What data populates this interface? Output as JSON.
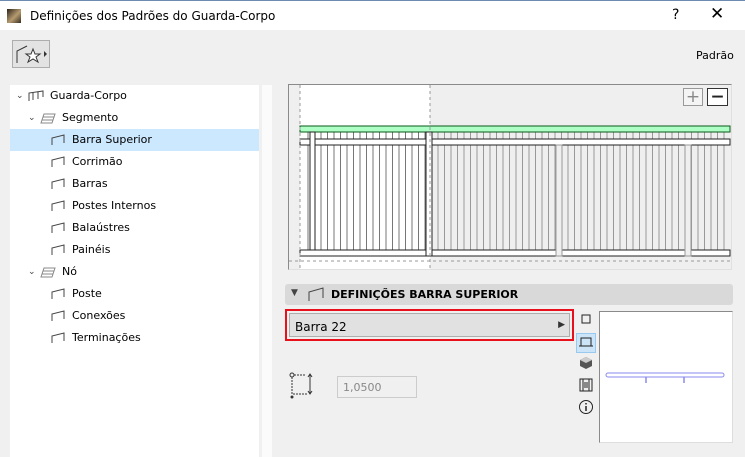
{
  "window": {
    "title": "Definições dos Padrões do Guarda-Corpo",
    "help": "?",
    "close": "✕"
  },
  "toolbar": {
    "favorites_icon": "railing-star-icon",
    "mode_label": "Padrão"
  },
  "tree": [
    {
      "label": "Guarda-Corpo",
      "level": 0,
      "expanded": true
    },
    {
      "label": "Segmento",
      "level": 1,
      "expanded": true
    },
    {
      "label": "Barra Superior",
      "level": 2,
      "selected": true
    },
    {
      "label": "Corrimão",
      "level": 2
    },
    {
      "label": "Barras",
      "level": 2
    },
    {
      "label": "Postes Internos",
      "level": 2
    },
    {
      "label": "Balaústres",
      "level": 2
    },
    {
      "label": "Painéis",
      "level": 2
    },
    {
      "label": "Nó",
      "level": 1,
      "expanded": true
    },
    {
      "label": "Poste",
      "level": 2
    },
    {
      "label": "Conexões",
      "level": 2
    },
    {
      "label": "Terminações",
      "level": 2
    }
  ],
  "preview": {
    "zoom_in": "+",
    "zoom_out": "−",
    "highlight_color": "#adffc6"
  },
  "settings": {
    "title": "DEFINIÇÕES BARRA SUPERIOR",
    "profile": "Barra 22",
    "height_value": "1,0500"
  },
  "colors": {
    "selection": "#cce8ff",
    "highlight_border": "#e8101a"
  }
}
